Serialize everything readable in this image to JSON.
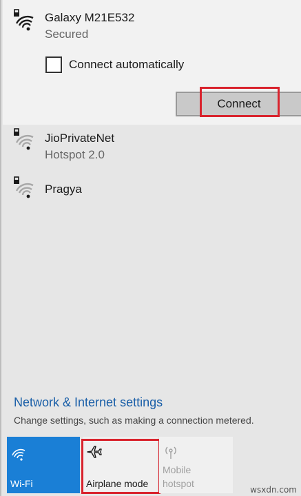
{
  "networks": [
    {
      "name": "Galaxy M21E532",
      "status": "Secured"
    },
    {
      "name": "JioPrivateNet",
      "status": "Hotspot 2.0"
    },
    {
      "name": "Pragya",
      "status": ""
    }
  ],
  "expanded": {
    "auto_connect_label": "Connect automatically",
    "connect_label": "Connect"
  },
  "settings": {
    "link": "Network & Internet settings",
    "description": "Change settings, such as making a connection metered."
  },
  "quick_actions": {
    "wifi_label": "Wi-Fi",
    "airplane_label": "Airplane mode",
    "hotspot_label_line1": "Mobile",
    "hotspot_label_line2": "hotspot"
  },
  "watermark": "wsxdn.com",
  "colors": {
    "accent": "#1a7fd6",
    "link": "#1a5fa8",
    "highlight": "#d9232d"
  },
  "icons": {
    "wifi_secured": "wifi-lock-icon",
    "airplane": "airplane-icon",
    "hotspot": "hotspot-icon"
  }
}
